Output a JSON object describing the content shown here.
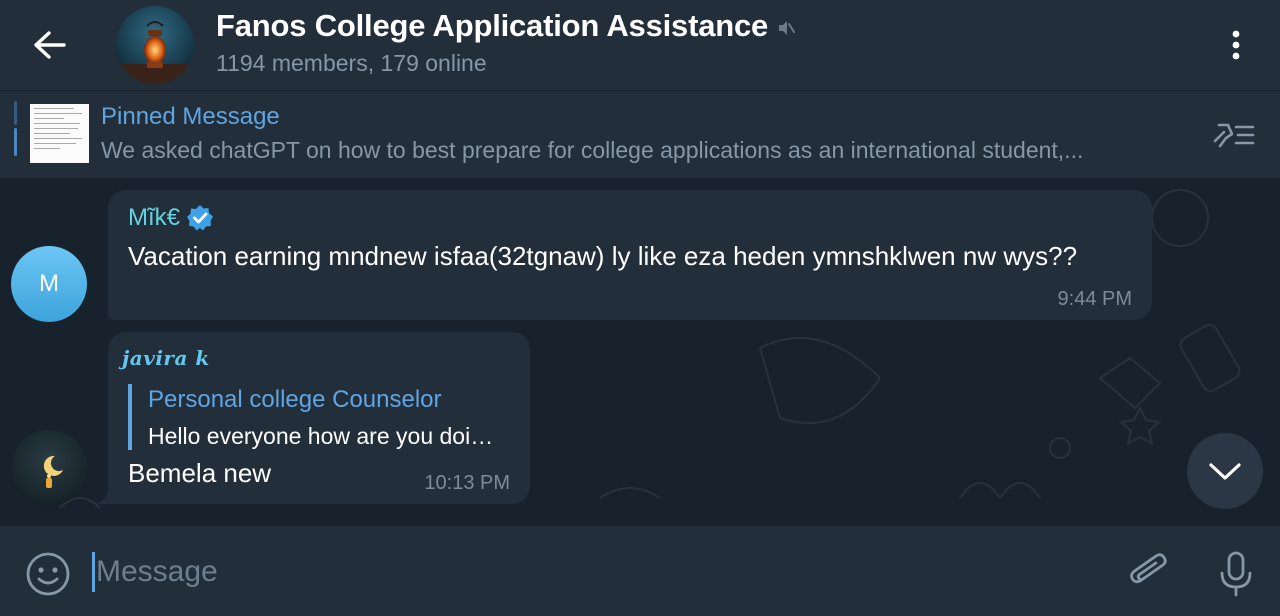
{
  "header": {
    "title": "Fanos College Application Assistance",
    "subtitle": "1194 members, 179 online",
    "back_icon": "arrow-left-icon",
    "muted_icon": "muted-speaker-icon",
    "menu_icon": "more-vertical-icon"
  },
  "pinned": {
    "title": "Pinned Message",
    "text": "We asked chatGPT on how to best prepare for college applications as an international student,...",
    "unpin_icon": "pin-list-icon"
  },
  "messages": [
    {
      "avatar_letter": "M",
      "sender": "Mĩk€",
      "verified": true,
      "text": "Vacation earning  mndnew  isfaa(32tgnaw) ly like eza heden ymnshklwen nw wys??",
      "time": "9:44 PM"
    },
    {
      "sender": "javira k",
      "reply_to": {
        "title": "Personal college Counselor",
        "text": "Hello everyone how are you doi…"
      },
      "text": "Bemela new",
      "time": "10:13 PM"
    }
  ],
  "composer": {
    "placeholder": "Message",
    "emoji_icon": "emoji-icon",
    "attach_icon": "paperclip-icon",
    "mic_icon": "microphone-icon"
  },
  "colors": {
    "header_bg": "#222e3a",
    "chat_bg": "#18222d",
    "bubble_bg": "#232e3b",
    "accent": "#5fa5e2",
    "sender_cyan": "#64d3e1",
    "muted_text": "#8797a6"
  }
}
